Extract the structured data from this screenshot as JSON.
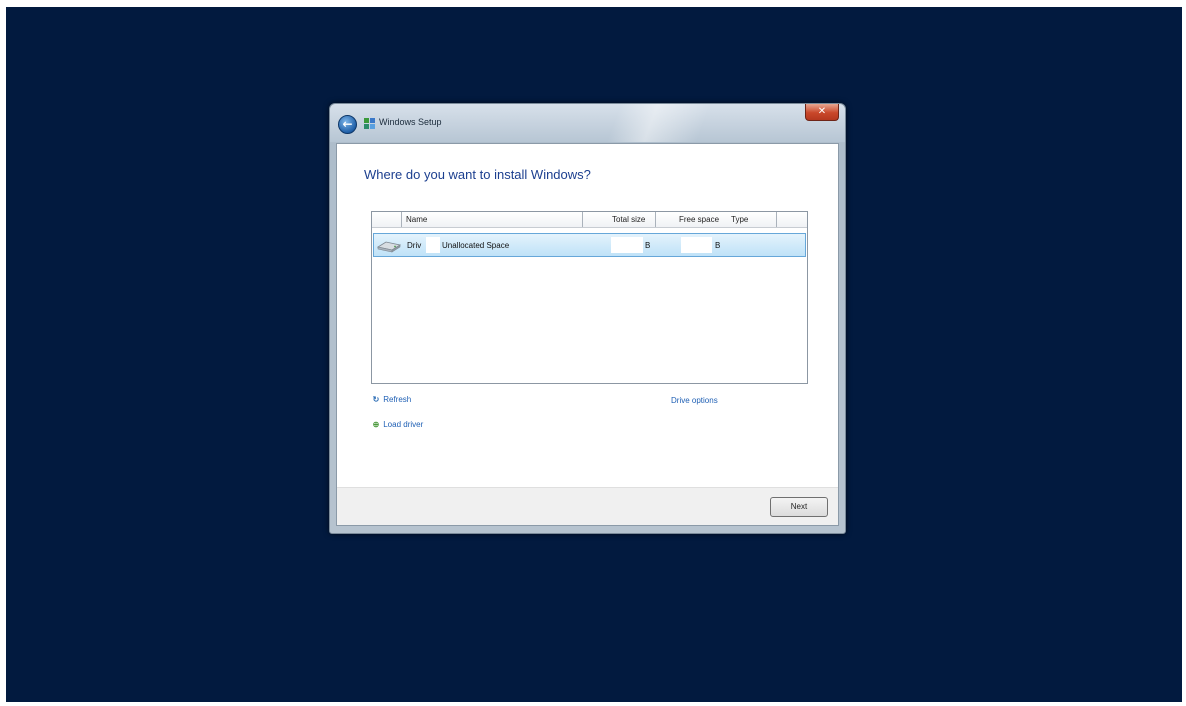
{
  "window": {
    "title": "Windows Setup",
    "back_glyph": "←",
    "close_glyph": "✕"
  },
  "page": {
    "heading": "Where do you want to install Windows?"
  },
  "drive_list": {
    "columns": [
      "Name",
      "Total size",
      "Free space",
      "Type"
    ],
    "rows": [
      {
        "name_prefix": "Driv",
        "name_suffix": "Unallocated Space",
        "total_size_unit": "B",
        "free_space_unit": "B",
        "type": "",
        "selected": true,
        "icon": "hard-disk-icon"
      }
    ]
  },
  "links": {
    "refresh": {
      "label": "Refresh",
      "icon": "refresh-icon"
    },
    "load_driver": {
      "label": "Load driver",
      "icon": "load-driver-icon"
    },
    "drive_options": {
      "label": "Drive options"
    }
  },
  "buttons": {
    "next": "Next"
  },
  "colors": {
    "desktop_bg": "#021a3f",
    "heading": "#1c3f8f",
    "link": "#1e5fb4",
    "selection": "#bfe2f8"
  }
}
